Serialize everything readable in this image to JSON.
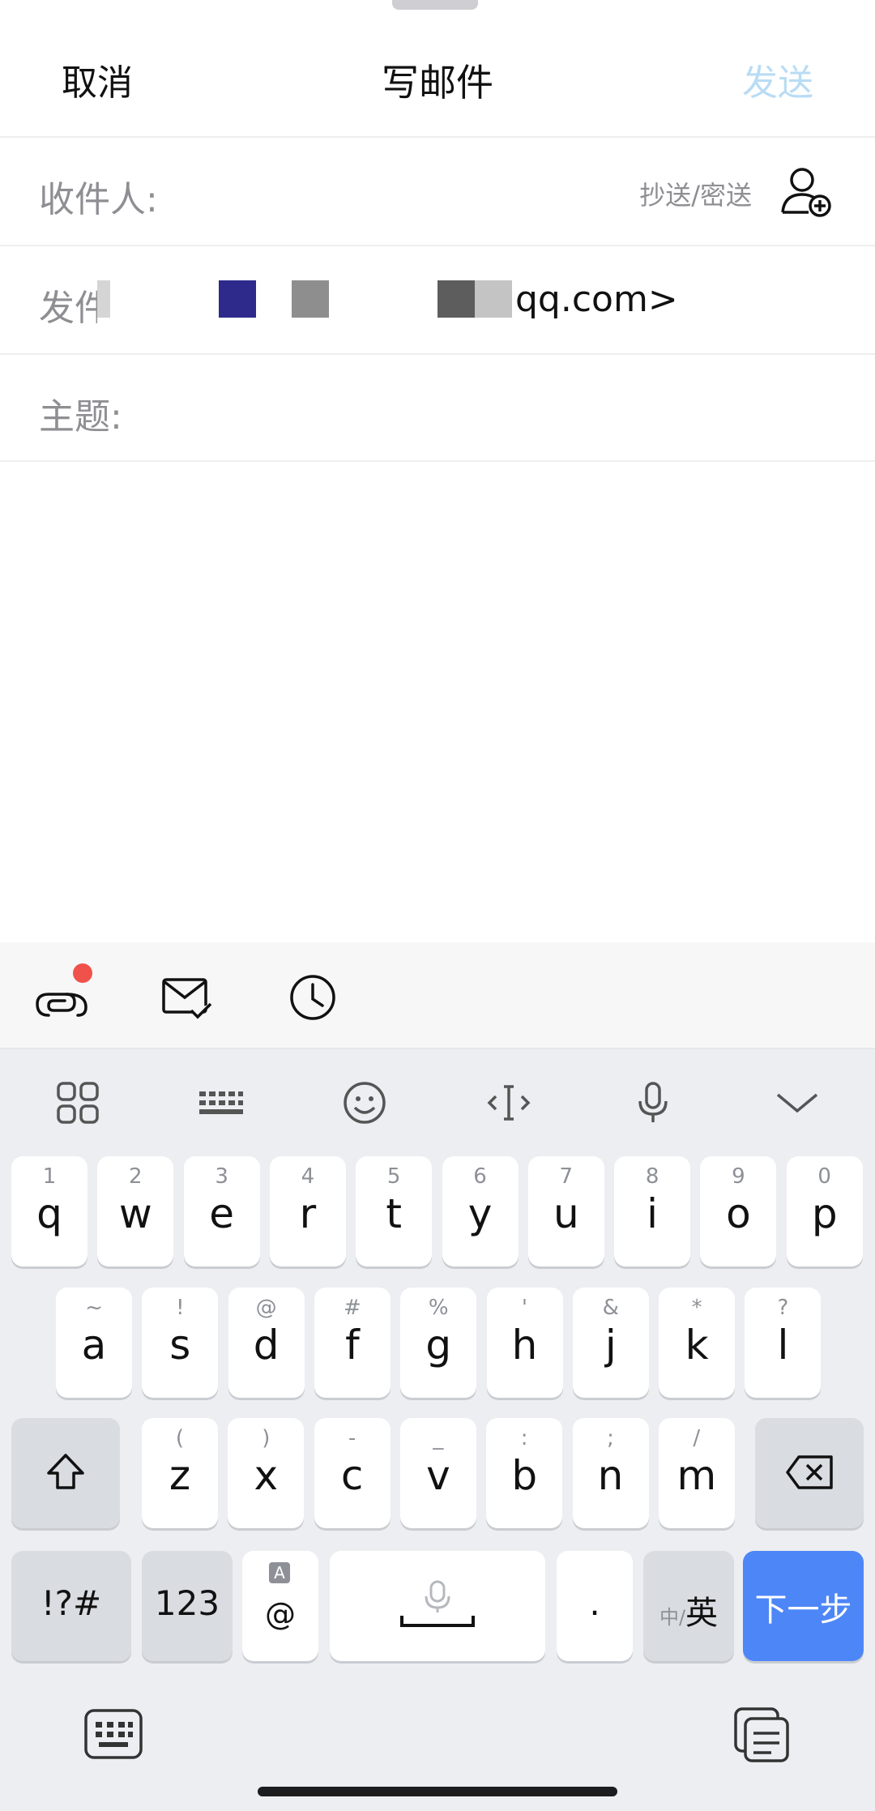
{
  "nav": {
    "cancel": "取消",
    "title": "写邮件",
    "send": "发送"
  },
  "fields": {
    "to_label": "收件人:",
    "cc_bcc": "抄送/密送",
    "from_label": "发件",
    "from_value": "qq.com>",
    "subject_label": "主题:"
  },
  "keyboard": {
    "row1": [
      {
        "main": "q",
        "sub": "1"
      },
      {
        "main": "w",
        "sub": "2"
      },
      {
        "main": "e",
        "sub": "3"
      },
      {
        "main": "r",
        "sub": "4"
      },
      {
        "main": "t",
        "sub": "5"
      },
      {
        "main": "y",
        "sub": "6"
      },
      {
        "main": "u",
        "sub": "7"
      },
      {
        "main": "i",
        "sub": "8"
      },
      {
        "main": "o",
        "sub": "9"
      },
      {
        "main": "p",
        "sub": "0"
      }
    ],
    "row2": [
      {
        "main": "a",
        "sub": "~"
      },
      {
        "main": "s",
        "sub": "!"
      },
      {
        "main": "d",
        "sub": "@"
      },
      {
        "main": "f",
        "sub": "#"
      },
      {
        "main": "g",
        "sub": "%"
      },
      {
        "main": "h",
        "sub": "'"
      },
      {
        "main": "j",
        "sub": "&"
      },
      {
        "main": "k",
        "sub": "*"
      },
      {
        "main": "l",
        "sub": "?"
      }
    ],
    "row3": [
      {
        "main": "z",
        "sub": "("
      },
      {
        "main": "x",
        "sub": ")"
      },
      {
        "main": "c",
        "sub": "-"
      },
      {
        "main": "v",
        "sub": "_"
      },
      {
        "main": "b",
        "sub": ":"
      },
      {
        "main": "n",
        "sub": ";"
      },
      {
        "main": "m",
        "sub": "/"
      }
    ],
    "symbols": "!?#",
    "numbers": "123",
    "at_sub": "A",
    "at_main": "@",
    "period": ".",
    "lang_small": "中/",
    "lang_big": "英",
    "next": "下一步"
  },
  "colors": {
    "accent": "#4d86f7",
    "send_disabled": "#b9dcf4",
    "badge": "#f0524b"
  }
}
